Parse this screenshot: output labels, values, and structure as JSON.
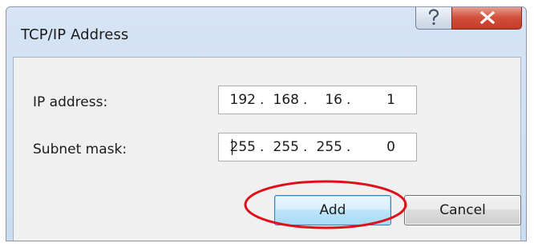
{
  "window": {
    "title": "TCP/IP Address",
    "help_icon": "question-mark-icon",
    "close_icon": "close-x-icon"
  },
  "fields": {
    "ip_address": {
      "label": "IP address:",
      "octets": [
        "192",
        "168",
        "16",
        "1"
      ]
    },
    "subnet_mask": {
      "label": "Subnet mask:",
      "octets": [
        "255",
        "255",
        "255",
        "0"
      ]
    }
  },
  "buttons": {
    "add_label": "Add",
    "cancel_label": "Cancel"
  },
  "annotation": {
    "type": "red-ellipse",
    "target": "add-button",
    "color": "#e0101a"
  },
  "colors": {
    "title_bar": "#c9dcf2",
    "close_button": "#c23b26",
    "dialog_body": "#f0f0f0",
    "default_button_border": "#3c7fb1"
  }
}
